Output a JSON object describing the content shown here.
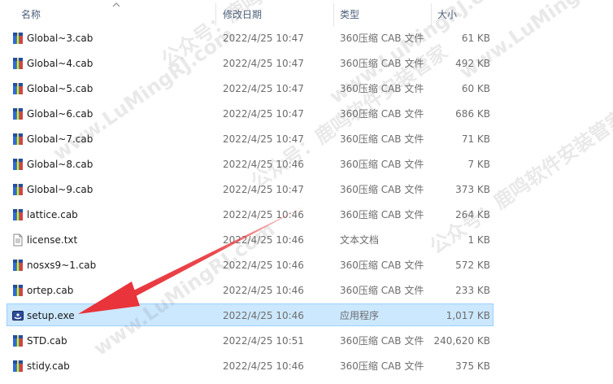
{
  "columns": {
    "name": "名称",
    "date": "修改日期",
    "type": "类型",
    "size": "大小"
  },
  "files": [
    {
      "name": "Global~3.cab",
      "date": "2022/4/25 10:47",
      "type": "360压缩 CAB 文件",
      "size": "61 KB",
      "icon": "cab-archive-icon"
    },
    {
      "name": "Global~4.cab",
      "date": "2022/4/25 10:47",
      "type": "360压缩 CAB 文件",
      "size": "492 KB",
      "icon": "cab-archive-icon"
    },
    {
      "name": "Global~5.cab",
      "date": "2022/4/25 10:47",
      "type": "360压缩 CAB 文件",
      "size": "60 KB",
      "icon": "cab-archive-icon"
    },
    {
      "name": "Global~6.cab",
      "date": "2022/4/25 10:47",
      "type": "360压缩 CAB 文件",
      "size": "686 KB",
      "icon": "cab-archive-icon"
    },
    {
      "name": "Global~7.cab",
      "date": "2022/4/25 10:47",
      "type": "360压缩 CAB 文件",
      "size": "71 KB",
      "icon": "cab-archive-icon"
    },
    {
      "name": "Global~8.cab",
      "date": "2022/4/25 10:46",
      "type": "360压缩 CAB 文件",
      "size": "7 KB",
      "icon": "cab-archive-icon"
    },
    {
      "name": "Global~9.cab",
      "date": "2022/4/25 10:47",
      "type": "360压缩 CAB 文件",
      "size": "373 KB",
      "icon": "cab-archive-icon"
    },
    {
      "name": "lattice.cab",
      "date": "2022/4/25 10:46",
      "type": "360压缩 CAB 文件",
      "size": "264 KB",
      "icon": "cab-archive-icon"
    },
    {
      "name": "license.txt",
      "date": "2022/4/25 10:46",
      "type": "文本文档",
      "size": "1 KB",
      "icon": "text-document-icon"
    },
    {
      "name": "nosxs9~1.cab",
      "date": "2022/4/25 10:46",
      "type": "360压缩 CAB 文件",
      "size": "572 KB",
      "icon": "cab-archive-icon"
    },
    {
      "name": "ortep.cab",
      "date": "2022/4/25 10:46",
      "type": "360压缩 CAB 文件",
      "size": "233 KB",
      "icon": "cab-archive-icon"
    },
    {
      "name": "setup.exe",
      "date": "2022/4/25 10:46",
      "type": "应用程序",
      "size": "1,017 KB",
      "icon": "setup-application-icon",
      "selected": true
    },
    {
      "name": "STD.cab",
      "date": "2022/4/25 10:51",
      "type": "360压缩 CAB 文件",
      "size": "240,620 KB",
      "icon": "cab-archive-icon"
    },
    {
      "name": "stidy.cab",
      "date": "2022/4/25 10:46",
      "type": "360压缩 CAB 文件",
      "size": "375 KB",
      "icon": "cab-archive-icon"
    }
  ],
  "watermark": {
    "cn": "公众号：鹿鸣软件安装管家",
    "en": "www.LuMingRJ.com"
  },
  "colors": {
    "selection_bg": "#cce8ff",
    "selection_border": "#99d1ff",
    "arrow": "#e8343a"
  }
}
